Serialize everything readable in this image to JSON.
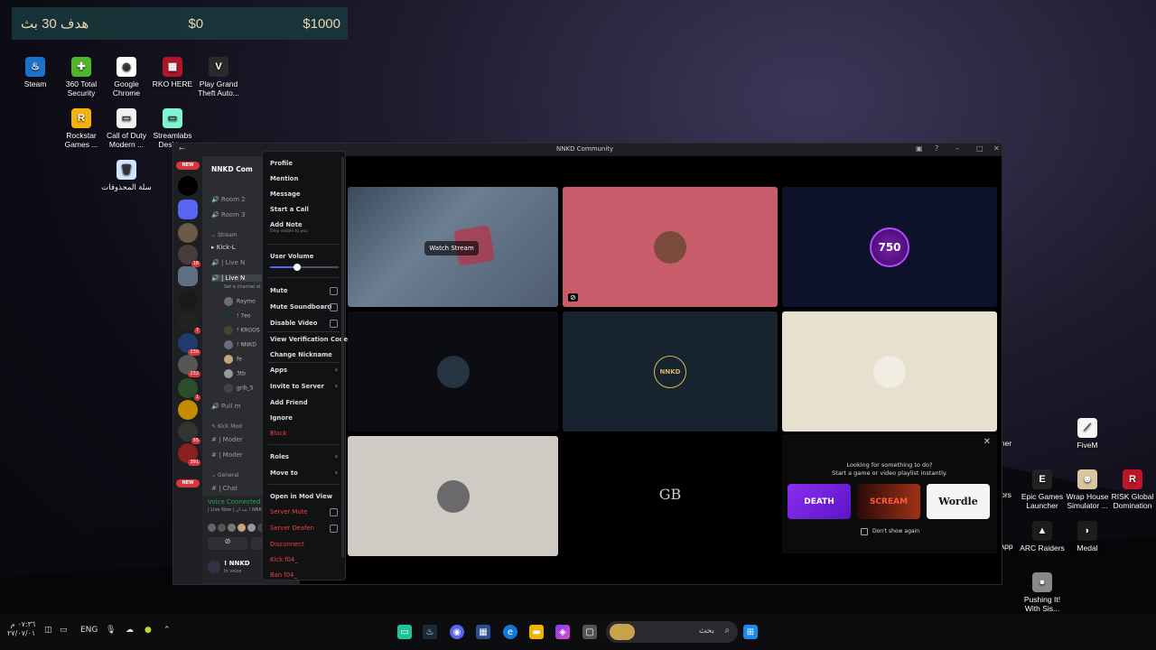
{
  "overlay": {
    "goal": "هدف 30 بث",
    "current": "$0",
    "target": "$1000"
  },
  "desktop_icons": [
    {
      "label": "Steam",
      "color": "#1b72c8",
      "glyph": "♨"
    },
    {
      "label": "360 Total Security",
      "color": "#4fb82a",
      "glyph": "✚"
    },
    {
      "label": "Google Chrome",
      "color": "#ffffff",
      "glyph": "◉"
    },
    {
      "label": "RKO HERE",
      "color": "#b0162a",
      "glyph": "▦"
    },
    {
      "label": "Play Grand Theft Auto...",
      "color": "#2a2a2a",
      "glyph": "V"
    },
    {
      "label": "Rockstar Games ...",
      "color": "#f4b20f",
      "glyph": "R"
    },
    {
      "label": "Call of Duty Modern ...",
      "color": "#f2f2f2",
      "glyph": "▭"
    },
    {
      "label": "Streamlabs Desktop",
      "color": "#80f5d2",
      "glyph": "▭"
    },
    {
      "label": "سلة المحذوفات",
      "color": "#cfe3ff",
      "glyph": "🗑"
    },
    {
      "label": "FiveM",
      "color": "#f5f5f5",
      "glyph": "⟋"
    },
    {
      "label": "Epic Games Launcher",
      "color": "#222222",
      "glyph": "E"
    },
    {
      "label": "Wrap House Simulator ...",
      "color": "#d9c6a0",
      "glyph": "☻"
    },
    {
      "label": "RISK Global Domination",
      "color": "#c0142a",
      "glyph": "R"
    },
    {
      "label": "ARC Raiders",
      "color": "#1d1d1d",
      "glyph": "▲"
    },
    {
      "label": "Medal",
      "color": "#1d1d1d",
      "glyph": "◗"
    },
    {
      "label": "Pushing It! With Sis...",
      "color": "#888888",
      "glyph": "●"
    },
    {
      "label": "her",
      "color": "#333",
      "glyph": ""
    },
    {
      "label": "ors",
      "color": "#333",
      "glyph": ""
    },
    {
      "label": "App",
      "color": "#333",
      "glyph": ""
    }
  ],
  "window": {
    "title": "NNKD Community"
  },
  "servers": {
    "new_badge": "NEW",
    "badges": [
      "18",
      "7",
      "230",
      "232",
      "1",
      "55",
      "391"
    ],
    "bottom_new": "NEW"
  },
  "channels": {
    "server_name": "NNKD Com",
    "rows": [
      "Room 2",
      "Room 3",
      "Stream",
      "Kick-L",
      "| Live N",
      "| Live N",
      "Set a channel st...",
      "Pull m",
      "Kick Mod",
      "| Moder",
      "| Moder",
      "General",
      "| Chat"
    ],
    "users": [
      "Raymo",
      "! 7eo",
      "! KROOS",
      "! NNKD",
      "fe",
      "3tb",
      "grib_5"
    ],
    "voice_connected": "Voice Connected",
    "voice_channel": "| Live Now | بث ان ! NNK",
    "user_name": "! NNKD",
    "user_status": "In voice"
  },
  "stream": {
    "watch": "Watch Stream"
  },
  "tiles": {
    "nnkd_logo": "NNKD",
    "logo_750": "750",
    "gb_logo": "GB"
  },
  "menu": {
    "profile": "Profile",
    "mention": "Mention",
    "message": "Message",
    "start_call": "Start a Call",
    "add_note": "Add Note",
    "note_sub": "Only visible to you",
    "user_volume": "User Volume",
    "volume_level": 0.4,
    "mute": "Mute",
    "mute_soundboard": "Mute Soundboard",
    "disable_video": "Disable Video",
    "view_verification": "View Verification Code",
    "change_nickname": "Change Nickname",
    "apps": "Apps",
    "invite": "Invite to Server",
    "add_friend": "Add Friend",
    "ignore": "Ignore",
    "block": "Block",
    "roles": "Roles",
    "move_to": "Move to",
    "open_mod_view": "Open in Mod View",
    "server_mute": "Server Mute",
    "server_deafen": "Server Deafen",
    "disconnect": "Disconnect",
    "kick": "Kick f04_",
    "ban": "Ban f04_"
  },
  "popup": {
    "title": "Looking for something to do?",
    "subtitle": "Start a game or video playlist instantly.",
    "games": [
      "DEATH",
      "SCREAM",
      "Wordle"
    ],
    "dont_show": "Don't show again"
  },
  "taskbar": {
    "search_placeholder": "بحث",
    "lang": "ENG",
    "time": "٠٧:٣٦ م",
    "date": "٢٧/٠٧/٠١"
  }
}
